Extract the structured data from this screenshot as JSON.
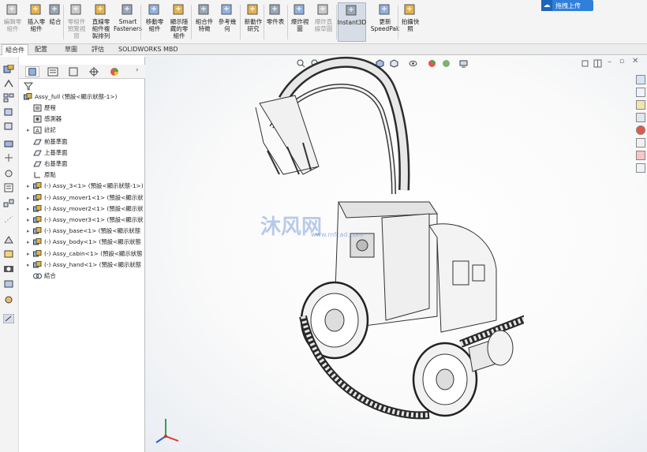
{
  "ribbon": {
    "buttons": [
      {
        "label": "編輯零\n組件",
        "disabled": true
      },
      {
        "label": "插入零\n組件",
        "disabled": false
      },
      {
        "label": "結合",
        "disabled": false
      },
      {
        "label": "零組件\n預覽視\n窗",
        "disabled": true
      },
      {
        "label": "直線零\n組件複\n製排列",
        "disabled": false
      },
      {
        "label": "Smart\nFasteners",
        "disabled": false
      },
      {
        "label": "移動零\n組件",
        "disabled": false
      },
      {
        "label": "顯示隱\n藏的零\n組件",
        "disabled": false
      },
      {
        "label": "組合件\n特徵",
        "disabled": false
      },
      {
        "label": "參考幾\n何",
        "disabled": false
      },
      {
        "label": "新動作\n研究",
        "disabled": false
      },
      {
        "label": "零件表",
        "disabled": false
      },
      {
        "label": "爆炸視\n圖",
        "disabled": false
      },
      {
        "label": "爆炸直\n線草圖",
        "disabled": true
      },
      {
        "label": "Instant3D",
        "disabled": false,
        "active": true
      },
      {
        "label": "更新\nSpeedPak",
        "disabled": false
      },
      {
        "label": "拍攝快\n照",
        "disabled": false
      }
    ],
    "upload_label": "拖拽上传"
  },
  "command_tabs": [
    "組合件",
    "配置",
    "草圖",
    "評估",
    "SOLIDWORKS MBD"
  ],
  "tree": {
    "root": "Assy_full (預設<顯示狀態-1>)",
    "items": [
      {
        "label": "歷程",
        "expand": false,
        "icon": "history-icon"
      },
      {
        "label": "感測器",
        "expand": false,
        "icon": "sensor-icon"
      },
      {
        "label": "註記",
        "expand": true,
        "icon": "annotation-icon"
      },
      {
        "label": "前基準面",
        "expand": false,
        "icon": "plane-icon"
      },
      {
        "label": "上基準面",
        "expand": false,
        "icon": "plane-icon"
      },
      {
        "label": "右基準面",
        "expand": false,
        "icon": "plane-icon"
      },
      {
        "label": "原點",
        "expand": false,
        "icon": "origin-icon"
      },
      {
        "label": "(-) Assy_3<1> (預設<顯示狀態-1>)",
        "expand": true,
        "icon": "subassembly-icon"
      },
      {
        "label": "(-) Assy_mover1<1> (預設<顯示狀",
        "expand": true,
        "icon": "subassembly-icon"
      },
      {
        "label": "(-) Assy_mover2<1> (預設<顯示狀",
        "expand": true,
        "icon": "subassembly-icon"
      },
      {
        "label": "(-) Assy_mover3<1> (預設<顯示狀",
        "expand": true,
        "icon": "subassembly-icon"
      },
      {
        "label": "(-) Assy_base<1> (預設<顯示狀態",
        "expand": true,
        "icon": "subassembly-icon"
      },
      {
        "label": "(-) Assy_body<1> (預設<顯示狀態",
        "expand": true,
        "icon": "subassembly-icon"
      },
      {
        "label": "(-) Assy_cabin<1> (預設<顯示狀態",
        "expand": true,
        "icon": "subassembly-icon"
      },
      {
        "label": "(-) Assy_hand<1> (預設<顯示狀態",
        "expand": true,
        "icon": "subassembly-icon"
      },
      {
        "label": "結合",
        "expand": false,
        "icon": "mates-icon"
      }
    ]
  },
  "watermark": {
    "text": "沐风网",
    "url": "www.mfcad.com"
  },
  "colors": {
    "accent": "#2f7fdb",
    "ribbon_bg": "#f4f4f4",
    "folder": "#e6b34a"
  }
}
